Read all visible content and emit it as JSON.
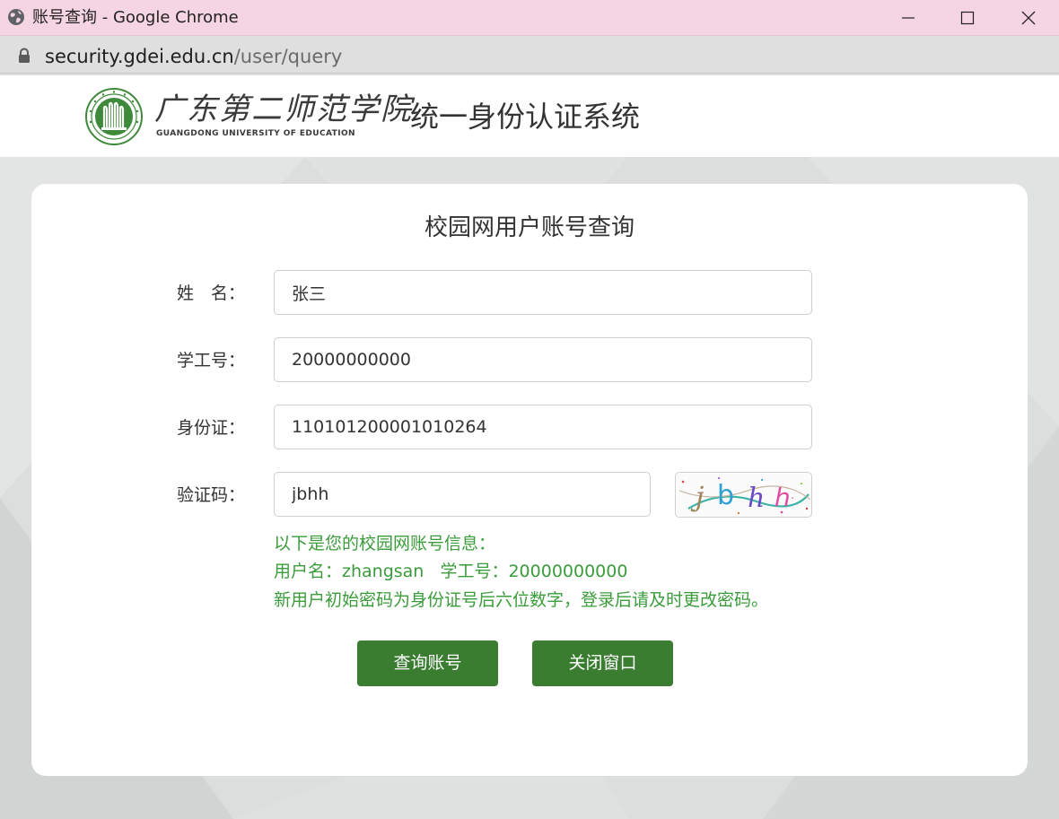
{
  "window": {
    "title": "账号查询 - Google Chrome"
  },
  "address_bar": {
    "host": "security.gdei.edu.cn",
    "path": "/user/query"
  },
  "header": {
    "school_name_cn": "广东第二师范学院",
    "school_name_en": "GUANGDONG UNIVERSITY OF EDUCATION",
    "system_title": "统一身份认证系统"
  },
  "form": {
    "title": "校园网用户账号查询",
    "name_label": "姓　名：",
    "name_value": "张三",
    "id_label": "学工号：",
    "id_value": "20000000000",
    "idcard_label": "身份证：",
    "idcard_value": "110101200001010264",
    "captcha_label": "验证码：",
    "captcha_value": "jbhh",
    "captcha_image_text": "jbhh"
  },
  "result": {
    "line1": "以下是您的校园网账号信息：",
    "line2": "用户名：zhangsan   学工号：20000000000",
    "line3": "新用户初始密码为身份证号后六位数字，登录后请及时更改密码。"
  },
  "buttons": {
    "query": "查询账号",
    "close": "关闭窗口"
  },
  "colors": {
    "titlebar": "#f6d5e3",
    "button_green": "#3a7d31",
    "result_green": "#3a9c3a"
  }
}
